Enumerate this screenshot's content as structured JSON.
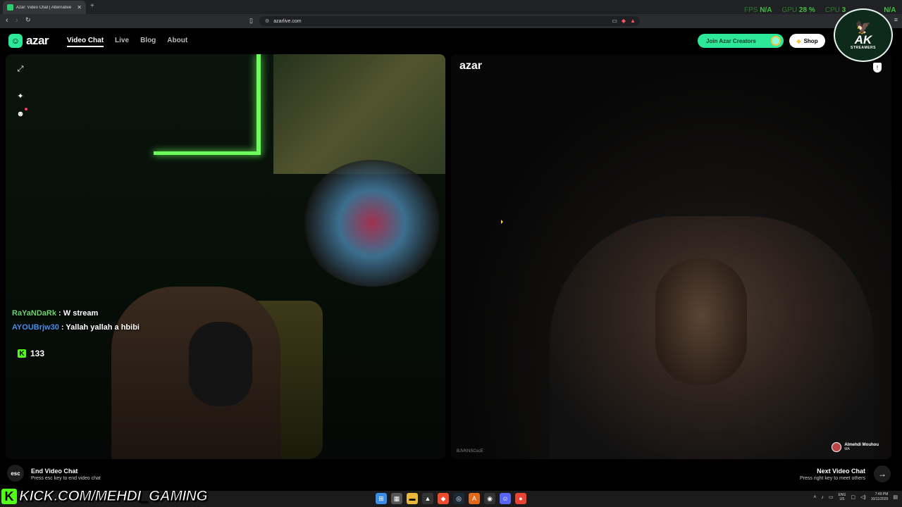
{
  "browser": {
    "tab_title": "Azar: Video Chat | Alternative",
    "url": "azarlive.com",
    "new_tab_label": "+"
  },
  "overlay": {
    "fps_label": "FPS",
    "fps_value": "N/A",
    "gpu_label": "GPU",
    "gpu_value": "28 %",
    "cpu_label": "CPU",
    "cpu_value": "3",
    "extra_value": "N/A"
  },
  "header": {
    "logo_text": "azar",
    "nav": [
      "Video Chat",
      "Live",
      "Blog",
      "About"
    ],
    "creators_label": "Join Azar Creators",
    "shop_label": "Shop"
  },
  "streamer_badge": {
    "text": "AK",
    "sub": "STREAMERS"
  },
  "left_panel": {
    "chat": [
      {
        "user": "RaYaNDaRk",
        "message": ": W stream"
      },
      {
        "user": "AYOUBrjw30",
        "message": ": Yallah yallah a hbibi"
      }
    ],
    "viewer_count": "133"
  },
  "right_panel": {
    "watermark": "azar",
    "session_id": "BJVKNSCxcE",
    "peer_name": "Almehdi Mouhou",
    "peer_country": "MA"
  },
  "bottom": {
    "esc_label": "esc",
    "end_title": "End Video Chat",
    "end_sub": "Press esc key to end video chat",
    "next_title": "Next Video Chat",
    "next_sub": "Press right key to meet others"
  },
  "kick_banner": "KICK.COM/MEHDI_GAMING",
  "tray": {
    "lang_1": "ENG",
    "lang_2": "US",
    "time": "7:49 PM",
    "date": "10/11/2025"
  },
  "colors": {
    "accent": "#2ee89a",
    "kick_green": "#53fc18",
    "chat_user_1": "#6fd36f",
    "chat_user_2": "#4a8fe8"
  }
}
